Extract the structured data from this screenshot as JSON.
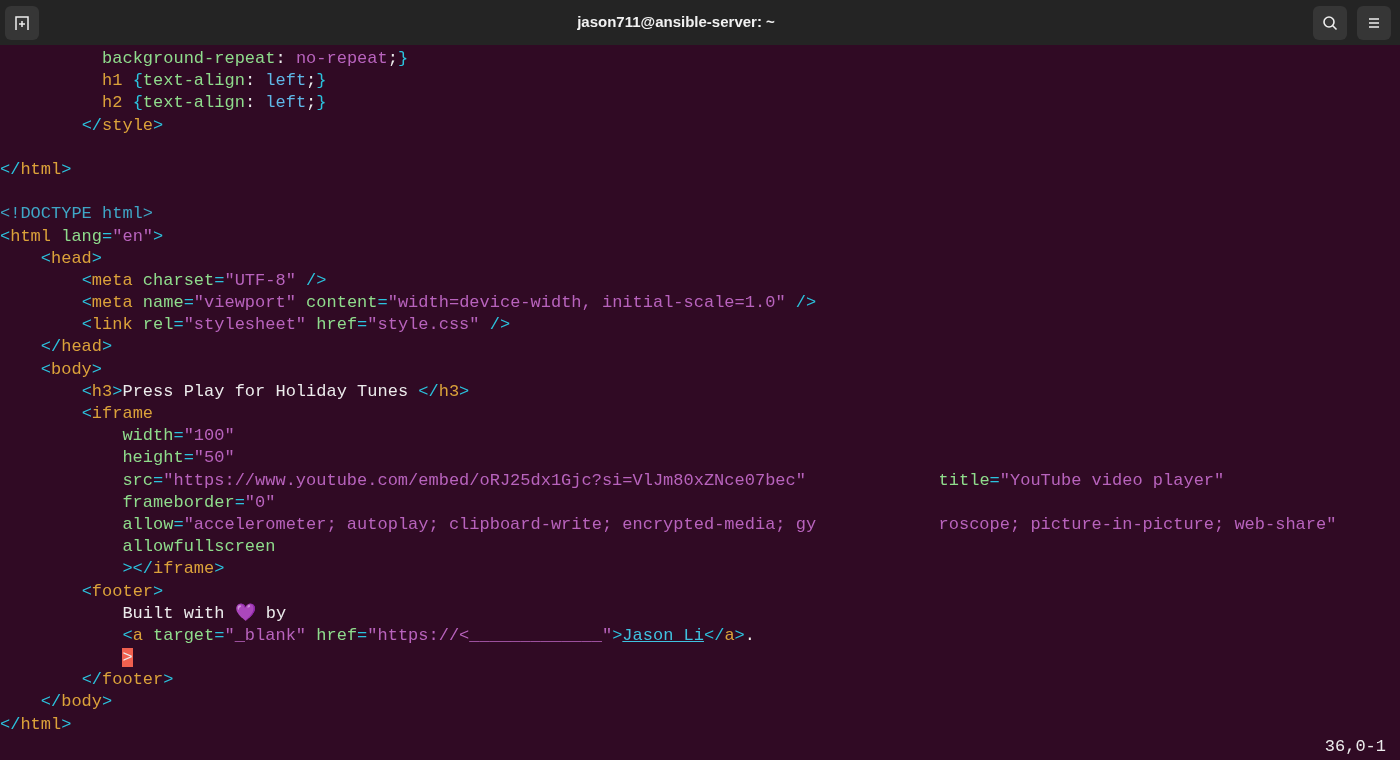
{
  "window": {
    "title": "jason711@ansible-server: ~"
  },
  "editor": {
    "lines": [
      {
        "kind": "code",
        "tokens": [
          {
            "text": "          background-repeat",
            "kind": "attr"
          },
          {
            "text": ": ",
            "kind": "txt"
          },
          {
            "text": "no-repeat",
            "kind": "str"
          },
          {
            "text": ";",
            "kind": "txt"
          },
          {
            "text": "}",
            "kind": "p"
          }
        ]
      },
      {
        "kind": "code",
        "tokens": [
          {
            "text": "          h1 ",
            "kind": "tag"
          },
          {
            "text": "{",
            "kind": "p"
          },
          {
            "text": "text-align",
            "kind": "attr"
          },
          {
            "text": ": ",
            "kind": "txt"
          },
          {
            "text": "left",
            "kind": "val"
          },
          {
            "text": ";",
            "kind": "txt"
          },
          {
            "text": "}",
            "kind": "p"
          }
        ]
      },
      {
        "kind": "code",
        "tokens": [
          {
            "text": "          h2 ",
            "kind": "tag"
          },
          {
            "text": "{",
            "kind": "p"
          },
          {
            "text": "text-align",
            "kind": "attr"
          },
          {
            "text": ": ",
            "kind": "txt"
          },
          {
            "text": "left",
            "kind": "val"
          },
          {
            "text": ";",
            "kind": "txt"
          },
          {
            "text": "}",
            "kind": "p"
          }
        ]
      },
      {
        "kind": "code",
        "tokens": [
          {
            "text": "        </",
            "kind": "p"
          },
          {
            "text": "style",
            "kind": "tag"
          },
          {
            "text": ">",
            "kind": "p"
          }
        ]
      },
      {
        "kind": "blank"
      },
      {
        "kind": "code",
        "tokens": [
          {
            "text": "</",
            "kind": "p"
          },
          {
            "text": "html",
            "kind": "tag"
          },
          {
            "text": ">",
            "kind": "p"
          }
        ]
      },
      {
        "kind": "blank"
      },
      {
        "kind": "code",
        "tokens": [
          {
            "text": "<!DOCTYPE html>",
            "kind": "doc"
          }
        ]
      },
      {
        "kind": "code",
        "tokens": [
          {
            "text": "<",
            "kind": "p"
          },
          {
            "text": "html",
            "kind": "tag"
          },
          {
            "text": " lang",
            "kind": "attr"
          },
          {
            "text": "=",
            "kind": "p"
          },
          {
            "text": "\"en\"",
            "kind": "str"
          },
          {
            "text": ">",
            "kind": "p"
          }
        ]
      },
      {
        "kind": "code",
        "tokens": [
          {
            "text": "    <",
            "kind": "p"
          },
          {
            "text": "head",
            "kind": "tag"
          },
          {
            "text": ">",
            "kind": "p"
          }
        ]
      },
      {
        "kind": "code",
        "tokens": [
          {
            "text": "        <",
            "kind": "p"
          },
          {
            "text": "meta",
            "kind": "tag"
          },
          {
            "text": " charset",
            "kind": "attr"
          },
          {
            "text": "=",
            "kind": "p"
          },
          {
            "text": "\"UTF-8\"",
            "kind": "str"
          },
          {
            "text": " />",
            "kind": "p"
          }
        ]
      },
      {
        "kind": "code",
        "tokens": [
          {
            "text": "        <",
            "kind": "p"
          },
          {
            "text": "meta",
            "kind": "tag"
          },
          {
            "text": " name",
            "kind": "attr"
          },
          {
            "text": "=",
            "kind": "p"
          },
          {
            "text": "\"viewport\"",
            "kind": "str"
          },
          {
            "text": " content",
            "kind": "attr"
          },
          {
            "text": "=",
            "kind": "p"
          },
          {
            "text": "\"width=device-width, initial-scale=1.0\"",
            "kind": "str"
          },
          {
            "text": " />",
            "kind": "p"
          }
        ]
      },
      {
        "kind": "code",
        "tokens": [
          {
            "text": "        <",
            "kind": "p"
          },
          {
            "text": "link",
            "kind": "tag"
          },
          {
            "text": " rel",
            "kind": "attr"
          },
          {
            "text": "=",
            "kind": "p"
          },
          {
            "text": "\"stylesheet\"",
            "kind": "str"
          },
          {
            "text": " href",
            "kind": "attr"
          },
          {
            "text": "=",
            "kind": "p"
          },
          {
            "text": "\"style.css\"",
            "kind": "str"
          },
          {
            "text": " />",
            "kind": "p"
          }
        ]
      },
      {
        "kind": "code",
        "tokens": [
          {
            "text": "    </",
            "kind": "p"
          },
          {
            "text": "head",
            "kind": "tag"
          },
          {
            "text": ">",
            "kind": "p"
          }
        ]
      },
      {
        "kind": "code",
        "tokens": [
          {
            "text": "    <",
            "kind": "p"
          },
          {
            "text": "body",
            "kind": "tag"
          },
          {
            "text": ">",
            "kind": "p"
          }
        ]
      },
      {
        "kind": "code",
        "tokens": [
          {
            "text": "        <",
            "kind": "p"
          },
          {
            "text": "h3",
            "kind": "tag"
          },
          {
            "text": ">",
            "kind": "p"
          },
          {
            "text": "Press Play for Holiday Tunes ",
            "kind": "txt"
          },
          {
            "text": "</",
            "kind": "p"
          },
          {
            "text": "h3",
            "kind": "tag"
          },
          {
            "text": ">",
            "kind": "p"
          }
        ]
      },
      {
        "kind": "code",
        "tokens": [
          {
            "text": "        <",
            "kind": "p"
          },
          {
            "text": "iframe",
            "kind": "tag"
          }
        ]
      },
      {
        "kind": "code",
        "tokens": [
          {
            "text": "            width",
            "kind": "attr"
          },
          {
            "text": "=",
            "kind": "p"
          },
          {
            "text": "\"100\"",
            "kind": "str"
          }
        ]
      },
      {
        "kind": "code",
        "tokens": [
          {
            "text": "            height",
            "kind": "attr"
          },
          {
            "text": "=",
            "kind": "p"
          },
          {
            "text": "\"50\"",
            "kind": "str"
          }
        ]
      },
      {
        "kind": "code",
        "tokens": [
          {
            "text": "            src",
            "kind": "attr"
          },
          {
            "text": "=",
            "kind": "p"
          },
          {
            "text": "\"https://www.youtube.com/embed/oRJ25dx1Gjc?si=VlJm80xZNce07bec\"",
            "kind": "str"
          },
          {
            "text": "             title",
            "kind": "attr"
          },
          {
            "text": "=",
            "kind": "p"
          },
          {
            "text": "\"YouTube video player\"",
            "kind": "str"
          }
        ]
      },
      {
        "kind": "code",
        "tokens": [
          {
            "text": "            frameborder",
            "kind": "attr"
          },
          {
            "text": "=",
            "kind": "p"
          },
          {
            "text": "\"0\"",
            "kind": "str"
          }
        ]
      },
      {
        "kind": "code",
        "tokens": [
          {
            "text": "            allow",
            "kind": "attr"
          },
          {
            "text": "=",
            "kind": "p"
          },
          {
            "text": "\"accelerometer; autoplay; clipboard-write; encrypted-media; gy            roscope; picture-in-picture; web-share\"",
            "kind": "str"
          }
        ]
      },
      {
        "kind": "code",
        "tokens": [
          {
            "text": "            allowfullscreen",
            "kind": "attr"
          }
        ]
      },
      {
        "kind": "code",
        "tokens": [
          {
            "text": "            ></",
            "kind": "p"
          },
          {
            "text": "iframe",
            "kind": "tag"
          },
          {
            "text": ">",
            "kind": "p"
          }
        ]
      },
      {
        "kind": "code",
        "tokens": [
          {
            "text": "        <",
            "kind": "p"
          },
          {
            "text": "footer",
            "kind": "tag"
          },
          {
            "text": ">",
            "kind": "p"
          }
        ]
      },
      {
        "kind": "code",
        "tokens": [
          {
            "text": "            Built with 💜 by",
            "kind": "txt"
          }
        ]
      },
      {
        "kind": "code",
        "tokens": [
          {
            "text": "            <",
            "kind": "p"
          },
          {
            "text": "a",
            "kind": "tag"
          },
          {
            "text": " target",
            "kind": "attr"
          },
          {
            "text": "=",
            "kind": "p"
          },
          {
            "text": "\"_blank\"",
            "kind": "str"
          },
          {
            "text": " href",
            "kind": "attr"
          },
          {
            "text": "=",
            "kind": "p"
          },
          {
            "text": "\"https://<_____________\"",
            "kind": "str"
          },
          {
            "text": ">",
            "kind": "p"
          },
          {
            "text": "Jason Li",
            "kind": "link"
          },
          {
            "text": "</",
            "kind": "p"
          },
          {
            "text": "a",
            "kind": "tag"
          },
          {
            "text": ">",
            "kind": "p"
          },
          {
            "text": ".",
            "kind": "txt"
          }
        ]
      },
      {
        "kind": "code",
        "tokens": [
          {
            "text": "            >",
            "kind": "cursor"
          }
        ]
      },
      {
        "kind": "code",
        "tokens": [
          {
            "text": "        </",
            "kind": "p"
          },
          {
            "text": "footer",
            "kind": "tag"
          },
          {
            "text": ">",
            "kind": "p"
          }
        ]
      },
      {
        "kind": "code",
        "tokens": [
          {
            "text": "    </",
            "kind": "p"
          },
          {
            "text": "body",
            "kind": "tag"
          },
          {
            "text": ">",
            "kind": "p"
          }
        ]
      },
      {
        "kind": "code",
        "tokens": [
          {
            "text": "</",
            "kind": "p"
          },
          {
            "text": "html",
            "kind": "tag"
          },
          {
            "text": ">",
            "kind": "p"
          }
        ]
      }
    ]
  },
  "status_bar": {
    "position": "36,0-1"
  }
}
